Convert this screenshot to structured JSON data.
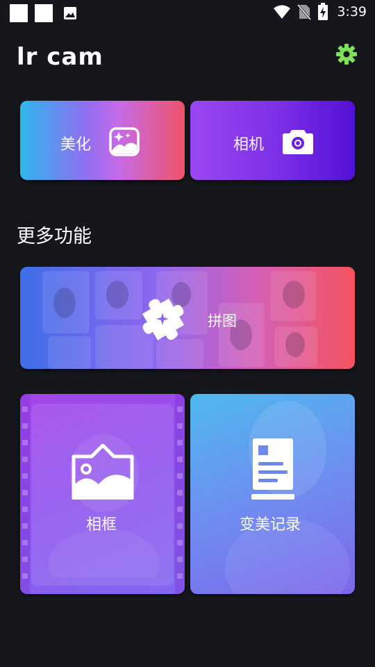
{
  "status_bar": {
    "time": "3:39",
    "icons": [
      "notification-square-icon",
      "notification-square-icon",
      "image-icon",
      "wifi-icon",
      "no-sim-icon",
      "battery-charging-icon"
    ]
  },
  "header": {
    "title": "lr cam",
    "settings_icon": "gear-icon"
  },
  "top_cards": {
    "beautify": {
      "label": "美化",
      "icon": "photo-sparkle-icon"
    },
    "camera": {
      "label": "相机",
      "icon": "camera-icon"
    }
  },
  "section": {
    "title": "更多功能"
  },
  "collage_card": {
    "label": "拼图",
    "icon": "puzzle-icon"
  },
  "bottom_cards": {
    "frame": {
      "label": "相框",
      "icon": "picture-frame-icon"
    },
    "history": {
      "label": "变美记录",
      "icon": "document-icon"
    }
  },
  "colors": {
    "background": "#15171d",
    "accent_settings": "#7fe05a",
    "beautify_gradient": [
      "#2fb7ec",
      "#c66be8",
      "#ef5268"
    ],
    "camera_gradient": [
      "#9a47f2",
      "#5410d6"
    ],
    "collage_gradient": [
      "#3d6ee8",
      "#8e66ef",
      "#f4535e"
    ],
    "frame_gradient": [
      "#a445e8",
      "#8268f0"
    ],
    "history_gradient": [
      "#4fb9ee",
      "#7e66ec"
    ]
  }
}
